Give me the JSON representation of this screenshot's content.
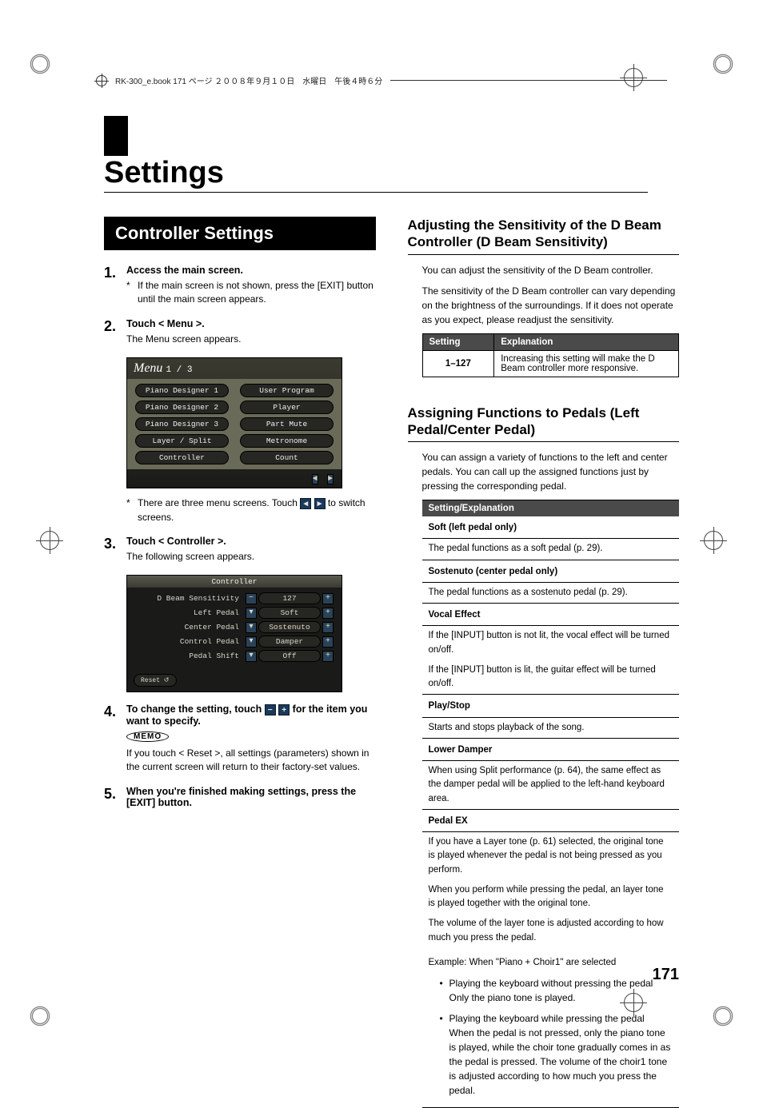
{
  "meta_header": "RK-300_e.book  171 ページ  ２００８年９月１０日　水曜日　午後４時６分",
  "chapter_title": "Settings",
  "section_banner": "Controller Settings",
  "steps": {
    "s1": {
      "num": "1.",
      "title": "Access the main screen.",
      "note": "If the main screen is not shown, press the [EXIT] button until the main screen appears."
    },
    "s2": {
      "num": "2.",
      "title": "Touch < Menu >.",
      "note": "The Menu screen appears."
    },
    "s2_b_pre": "There are three menu screens. Touch ",
    "s2_b_post": " to switch screens.",
    "s3": {
      "num": "3.",
      "title": "Touch < Controller >.",
      "note": "The following screen appears."
    },
    "s4": {
      "num": "4.",
      "title_pre": "To change the setting, touch ",
      "title_post": " for the item you want to specify.",
      "memo_label": "MEMO",
      "memo": "If you touch < Reset >, all settings (parameters) shown in the current screen will return to their factory-set values."
    },
    "s5": {
      "num": "5.",
      "title": "When you're finished making settings, press the [EXIT] button."
    }
  },
  "menu_shot": {
    "title": "Menu",
    "page": "1 / 3",
    "items_l": [
      "Piano Designer 1",
      "Piano Designer 2",
      "Piano Designer 3",
      "Layer / Split",
      "Controller"
    ],
    "items_r": [
      "User Program",
      "Player",
      "Part Mute",
      "Metronome",
      "Count"
    ],
    "arrows": "◄  ►"
  },
  "ctrl_shot": {
    "title": "Controller",
    "rows": [
      {
        "label": "D Beam Sensitivity",
        "minus": "−",
        "val": "127",
        "plus": "+"
      },
      {
        "label": "Left Pedal",
        "minus": "",
        "val": "Soft",
        "plus": "+"
      },
      {
        "label": "Center Pedal",
        "minus": "",
        "val": "Sostenuto",
        "plus": "+"
      },
      {
        "label": "Control Pedal",
        "minus": "",
        "val": "Damper",
        "plus": "+"
      },
      {
        "label": "Pedal Shift",
        "minus": "",
        "val": "Off",
        "plus": "+"
      }
    ],
    "reset": "Reset  ↺"
  },
  "h3_dbeam": "Adjusting the Sensitivity of the D Beam Controller (D Beam Sensitivity)",
  "dbeam_p1": "You can adjust the sensitivity of the D Beam controller.",
  "dbeam_p2": "The sensitivity of the D Beam controller can vary depending on the brightness of the surroundings. If it does not operate as you expect, please readjust the sensitivity.",
  "dbeam_table": {
    "h1": "Setting",
    "h2": "Explanation",
    "c1": "1–127",
    "c2": "Increasing this setting will make the D Beam controller more responsive."
  },
  "h3_pedal": "Assigning Functions to Pedals (Left Pedal/Center Pedal)",
  "pedal_intro": "You can assign a variety of functions to the left and center pedals. You can call up the assigned functions just by pressing the corresponding pedal.",
  "pedal_table": {
    "header": "Setting/Explanation",
    "rows": [
      {
        "h": "Soft (left pedal only)",
        "b": "The pedal functions as a soft pedal (p. 29)."
      },
      {
        "h": "Sostenuto (center pedal only)",
        "b": "The pedal functions as a sostenuto pedal (p. 29)."
      },
      {
        "h": "Vocal Effect",
        "b": "If the [INPUT] button is not lit, the vocal effect will be turned on/off.",
        "b2": "If the [INPUT] button is lit, the guitar effect will be turned on/off."
      },
      {
        "h": "Play/Stop",
        "b": "Starts and stops playback of the song."
      },
      {
        "h": "Lower Damper",
        "b": "When using Split performance (p. 64), the same effect as the damper pedal will be applied to the left-hand keyboard area."
      },
      {
        "h": "Pedal EX",
        "b": "If you have a Layer tone (p. 61) selected, the original tone is played whenever the pedal is not being pressed as you perform.",
        "b2": "When you perform while pressing the pedal, an layer tone is played together with the original tone.",
        "b3": "The volume of the layer tone is adjusted according to how much you press the pedal."
      }
    ]
  },
  "example_label": "Example: When \"Piano + Choir1\" are selected",
  "bullets": [
    {
      "a": "Playing the keyboard without pressing the pedal",
      "b": "Only the piano tone is played."
    },
    {
      "a": "Playing the keyboard while pressing the pedal",
      "b": "When the pedal is not pressed, only the piano tone is played, while the choir tone gradually comes in as the pedal is pressed. The volume of the choir1 tone is adjusted according to how much you press the pedal."
    }
  ],
  "page_num": "171",
  "icons": {
    "left": "◄",
    "right": "►",
    "minus": "−",
    "plus": "+"
  }
}
